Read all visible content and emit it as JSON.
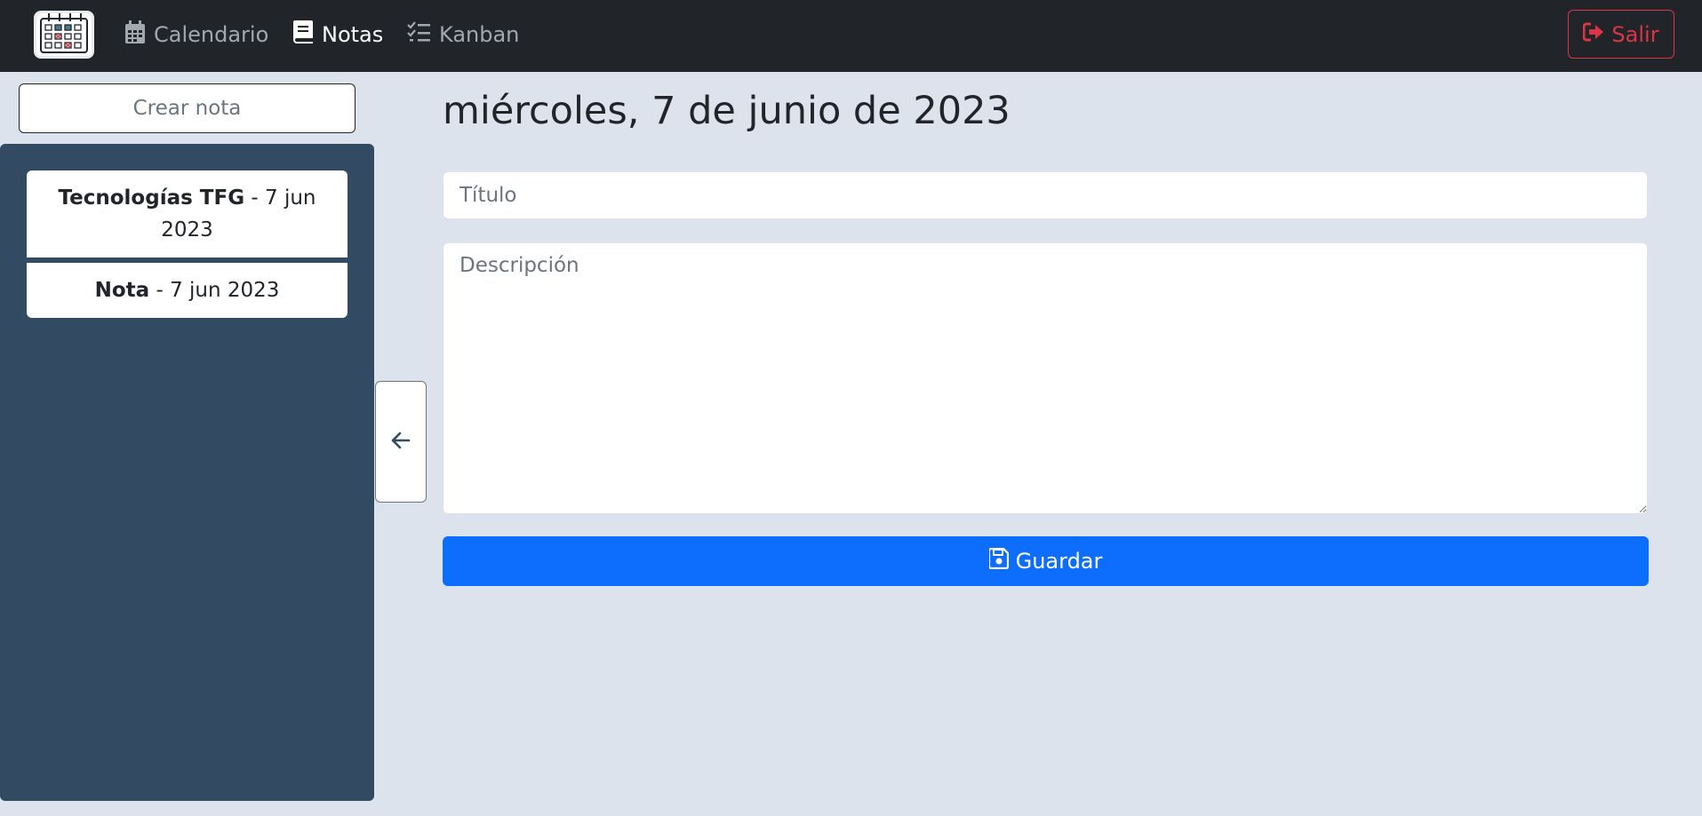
{
  "navbar": {
    "logo_icon": "calendar-logo-icon",
    "items": [
      {
        "label": "Calendario",
        "icon": "calendar-icon",
        "active": false
      },
      {
        "label": "Notas",
        "icon": "notebook-icon",
        "active": true
      },
      {
        "label": "Kanban",
        "icon": "checklist-icon",
        "active": false
      }
    ],
    "logout_label": "Salir",
    "logout_icon": "sign-out-icon"
  },
  "sidebar": {
    "create_label": "Crear nota",
    "notes": [
      {
        "title": "Tecnologías TFG",
        "date": " - 7 jun 2023"
      },
      {
        "title": "Nota",
        "date": " - 7 jun 2023"
      }
    ],
    "toggle_icon": "arrow-left-icon"
  },
  "main": {
    "date_heading": "miércoles, 7 de junio de 2023",
    "title_placeholder": "Título",
    "description_placeholder": "Descripción",
    "save_label": "Guardar",
    "save_icon": "floppy-disk-icon"
  },
  "colors": {
    "navbar_bg": "#212529",
    "page_bg": "#dce3ec",
    "sidebar_bg": "#324b63",
    "primary": "#0d6efd",
    "danger": "#dc3545"
  }
}
